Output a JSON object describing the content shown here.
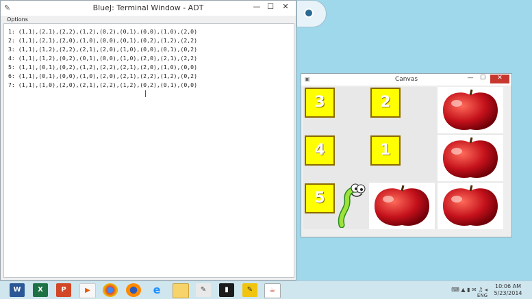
{
  "terminal": {
    "title": "BlueJ: Terminal Window - ADT",
    "menu_options": "Options",
    "lines": [
      "1: (1,1),(2,1),(2,2),(1,2),(0,2),(0,1),(0,0),(1,0),(2,0)",
      "2: (1,1),(2,1),(2,0),(1,0),(0,0),(0,1),(0,2),(1,2),(2,2)",
      "3: (1,1),(1,2),(2,2),(2,1),(2,0),(1,0),(0,0),(0,1),(0,2)",
      "4: (1,1),(1,2),(0,2),(0,1),(0,0),(1,0),(2,0),(2,1),(2,2)",
      "5: (1,1),(0,1),(0,2),(1,2),(2,2),(2,1),(2,0),(1,0),(0,0)",
      "6: (1,1),(0,1),(0,0),(1,0),(2,0),(2,1),(2,2),(1,2),(0,2)",
      "7: (1,1),(1,0),(2,0),(2,1),(2,2),(1,2),(0,2),(0,1),(0,0)"
    ]
  },
  "canvas": {
    "title": "Canvas",
    "close_glyph": "✕",
    "min_glyph": "—",
    "max_glyph": "☐",
    "tiles": {
      "r0c0": "3",
      "r0c1": "2",
      "r1c0": "4",
      "r1c1": "1",
      "r2c0": "5"
    },
    "icons": [
      "apple-icon",
      "worm-icon"
    ]
  },
  "window_controls": {
    "min": "—",
    "max": "☐",
    "close": "✕"
  },
  "taskbar": {
    "apps": [
      "word-icon",
      "excel-icon",
      "powerpoint-icon",
      "media-player-icon",
      "chrome-icon",
      "firefox-icon",
      "ie-icon",
      "file-explorer-icon",
      "bluej-icon",
      "cmd-icon",
      "java-icon",
      "bluej-icon-2"
    ],
    "tray_lang": "ENG",
    "time": "10:06 AM",
    "date": "5/23/2014"
  },
  "colors": {
    "tile_yellow": "#ffff00",
    "desktop": "#9fd8ea",
    "close_red": "#c7372e"
  }
}
